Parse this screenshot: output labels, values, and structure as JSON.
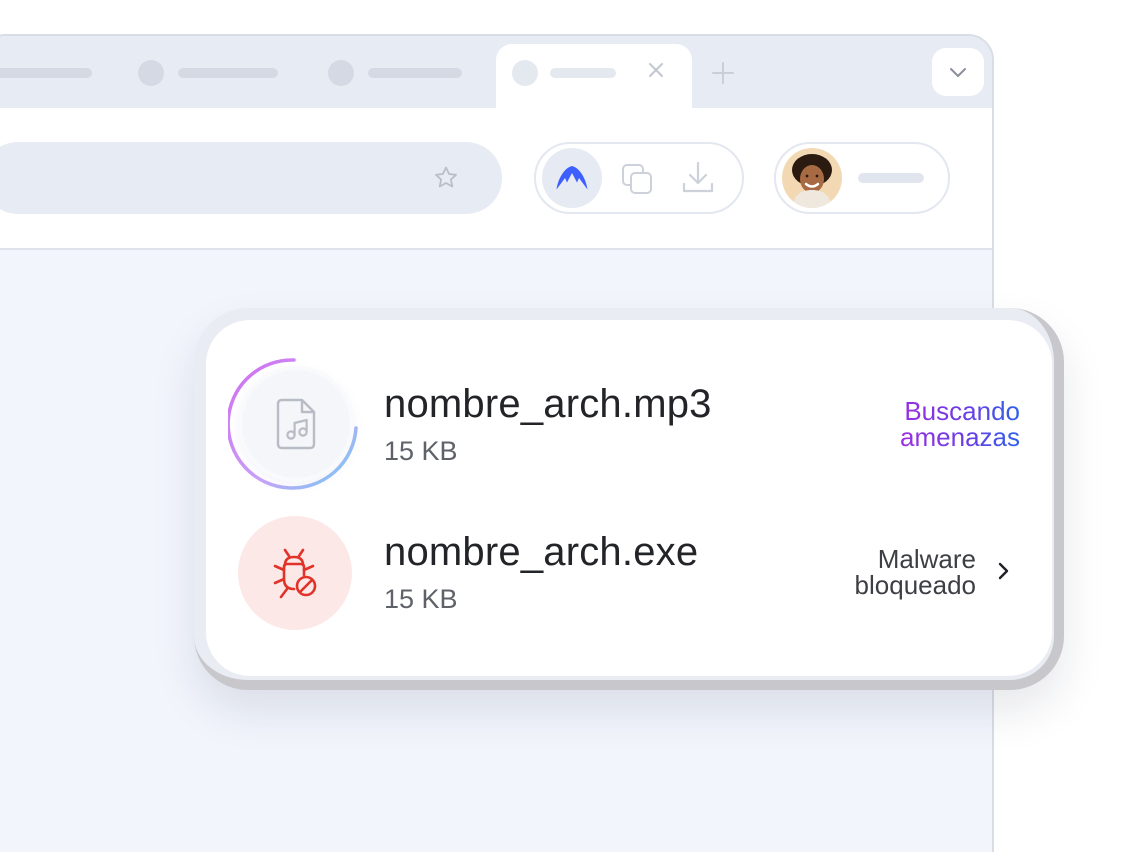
{
  "browser": {
    "tabs": [
      {
        "name": "inactive-tab-1",
        "label": ""
      },
      {
        "name": "inactive-tab-2",
        "label": ""
      },
      {
        "name": "inactive-tab-3",
        "label": ""
      },
      {
        "name": "active-tab",
        "label": ""
      }
    ],
    "icons": {
      "close": "close-icon",
      "new_tab": "plus-icon",
      "tab_menu": "chevron-down-icon",
      "bookmark": "star-icon",
      "nordvpn": "nordvpn-icon",
      "copy": "copy-icon",
      "download": "download-icon"
    }
  },
  "downloads": {
    "items": [
      {
        "filename": "nombre_arch.mp3",
        "size": "15 KB",
        "status": [
          "Buscando",
          "amenazas"
        ],
        "state": "scanning",
        "icon": "music-file-icon"
      },
      {
        "filename": "nombre_arch.exe",
        "size": "15 KB",
        "status": [
          "Malware",
          "bloqueado"
        ],
        "state": "blocked",
        "icon": "bug-blocked-icon"
      }
    ]
  },
  "colors": {
    "accent_nord": "#3e5fff",
    "scan_gradient_start": "#9b2fe0",
    "scan_gradient_end": "#2f62e8",
    "malware_red": "#e0332a",
    "malware_bg": "#fce8e7"
  }
}
